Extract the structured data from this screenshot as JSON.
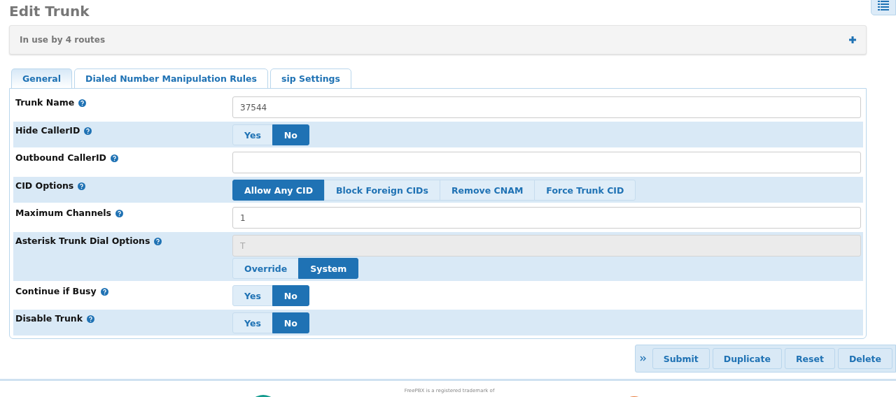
{
  "page_title": "Edit Trunk",
  "usage_panel": {
    "text": "In use by 4 routes",
    "expanded": false
  },
  "tabs": [
    {
      "label": "General",
      "selected": true
    },
    {
      "label": "Dialed Number Manipulation Rules",
      "selected": false
    },
    {
      "label": "sip Settings",
      "selected": false
    }
  ],
  "fields": [
    {
      "kind": "text",
      "label": "Trunk Name",
      "value": "37544",
      "disabled": false
    },
    {
      "kind": "choice",
      "label": "Hide CallerID",
      "options": [
        {
          "label": "Yes",
          "selected": false
        },
        {
          "label": "No",
          "selected": true
        }
      ]
    },
    {
      "kind": "text",
      "label": "Outbound CallerID",
      "disabled": false
    },
    {
      "kind": "choice",
      "label": "CID Options",
      "options": [
        {
          "label": "Allow Any CID",
          "selected": true
        },
        {
          "label": "Block Foreign CIDs",
          "selected": false
        },
        {
          "label": "Remove CNAM",
          "selected": false
        },
        {
          "label": "Force Trunk CID",
          "selected": false
        }
      ]
    },
    {
      "kind": "text",
      "label": "Maximum Channels",
      "value": "1",
      "disabled": false
    },
    {
      "kind": "text_choice",
      "label": "Asterisk Trunk Dial Options",
      "value": "T",
      "disabled": true,
      "options": [
        {
          "label": "Override",
          "selected": false
        },
        {
          "label": "System",
          "selected": true
        }
      ]
    },
    {
      "kind": "choice",
      "label": "Continue if Busy",
      "options": [
        {
          "label": "Yes",
          "selected": false
        },
        {
          "label": "No",
          "selected": true
        }
      ]
    },
    {
      "kind": "choice",
      "label": "Disable Trunk",
      "options": [
        {
          "label": "Yes",
          "selected": false
        },
        {
          "label": "No",
          "selected": true
        }
      ]
    }
  ],
  "action_bar": {
    "buttons": [
      "Submit",
      "Duplicate",
      "Reset",
      "Delete"
    ]
  },
  "footer": {
    "text": "FreePBX is a registered trademark of"
  }
}
